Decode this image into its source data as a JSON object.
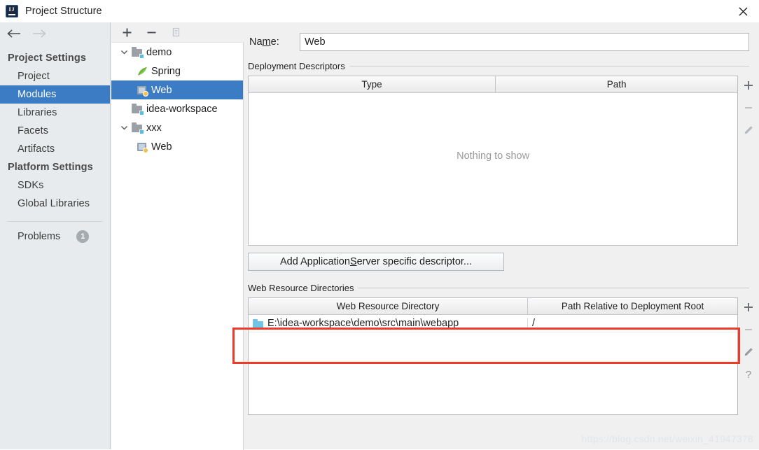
{
  "window": {
    "title": "Project Structure",
    "app_icon": "intellij-idea-logo",
    "close_icon": "close-icon"
  },
  "sidebar": {
    "nav": {
      "back_icon": "arrow-left-icon",
      "forward_icon": "arrow-right-icon"
    },
    "groups": [
      {
        "label": "Project Settings",
        "items": [
          {
            "label": "Project",
            "selected": false
          },
          {
            "label": "Modules",
            "selected": true
          },
          {
            "label": "Libraries",
            "selected": false
          },
          {
            "label": "Facets",
            "selected": false
          },
          {
            "label": "Artifacts",
            "selected": false
          }
        ]
      },
      {
        "label": "Platform Settings",
        "items": [
          {
            "label": "SDKs",
            "selected": false
          },
          {
            "label": "Global Libraries",
            "selected": false
          }
        ]
      }
    ],
    "problems": {
      "label": "Problems",
      "count": "1"
    }
  },
  "tree_panel": {
    "toolbar": [
      {
        "name": "add-module-button",
        "icon": "plus-icon",
        "enabled": true
      },
      {
        "name": "remove-module-button",
        "icon": "minus-icon",
        "enabled": true
      },
      {
        "name": "copy-module-button",
        "icon": "copy-icon",
        "enabled": false
      }
    ],
    "nodes": [
      {
        "label": "demo",
        "icon": "module-folder-icon",
        "depth": 0,
        "expanded": true,
        "selected": false
      },
      {
        "label": "Spring",
        "icon": "spring-leaf-icon",
        "depth": 1,
        "expanded": null,
        "selected": false
      },
      {
        "label": "Web",
        "icon": "web-facet-icon",
        "depth": 1,
        "expanded": null,
        "selected": true
      },
      {
        "label": "idea-workspace",
        "icon": "module-folder-icon",
        "depth": 0,
        "expanded": null,
        "selected": false
      },
      {
        "label": "xxx",
        "icon": "module-folder-icon",
        "depth": 0,
        "expanded": true,
        "selected": false
      },
      {
        "label": "Web",
        "icon": "web-facet-icon",
        "depth": 1,
        "expanded": null,
        "selected": false
      }
    ]
  },
  "main": {
    "name_field": {
      "label_pre": "Na",
      "label_mnemonic": "m",
      "label_post": "e:",
      "value": "Web",
      "placeholder": ""
    },
    "deployment_descriptors": {
      "title": "Deployment Descriptors",
      "columns": [
        "Type",
        "Path"
      ],
      "rows": [],
      "empty_text": "Nothing to show",
      "tools": [
        {
          "name": "add-descriptor-button",
          "icon": "plus-icon"
        },
        {
          "name": "remove-descriptor-button",
          "icon": "minus-icon"
        },
        {
          "name": "edit-descriptor-button",
          "icon": "pencil-icon"
        }
      ],
      "button": {
        "pre": "Add Application ",
        "mnemonic": "S",
        "post": "erver specific descriptor..."
      }
    },
    "web_resource_directories": {
      "title": "Web Resource Directories",
      "columns": [
        "Web Resource Directory",
        "Path Relative to Deployment Root"
      ],
      "rows": [
        {
          "icon": "directory-icon",
          "directory": "E:\\idea-workspace\\demo\\src\\main\\webapp",
          "relative_path": "/"
        }
      ],
      "tools": [
        {
          "name": "add-web-resource-button",
          "icon": "plus-icon"
        },
        {
          "name": "remove-web-resource-button",
          "icon": "minus-icon"
        },
        {
          "name": "edit-web-resource-button",
          "icon": "pencil-icon"
        },
        {
          "name": "help-button",
          "icon": "question-mark-icon"
        }
      ]
    }
  },
  "annotation": {
    "highlight_color": "#ee3b28"
  },
  "watermark": {
    "text": "https://blog.csdn.net/weixin_41947378"
  },
  "colors": {
    "selection": "#3b7cc4",
    "sidebar_bg": "#e8ebed",
    "panel_bg": "#f0f0f0"
  }
}
